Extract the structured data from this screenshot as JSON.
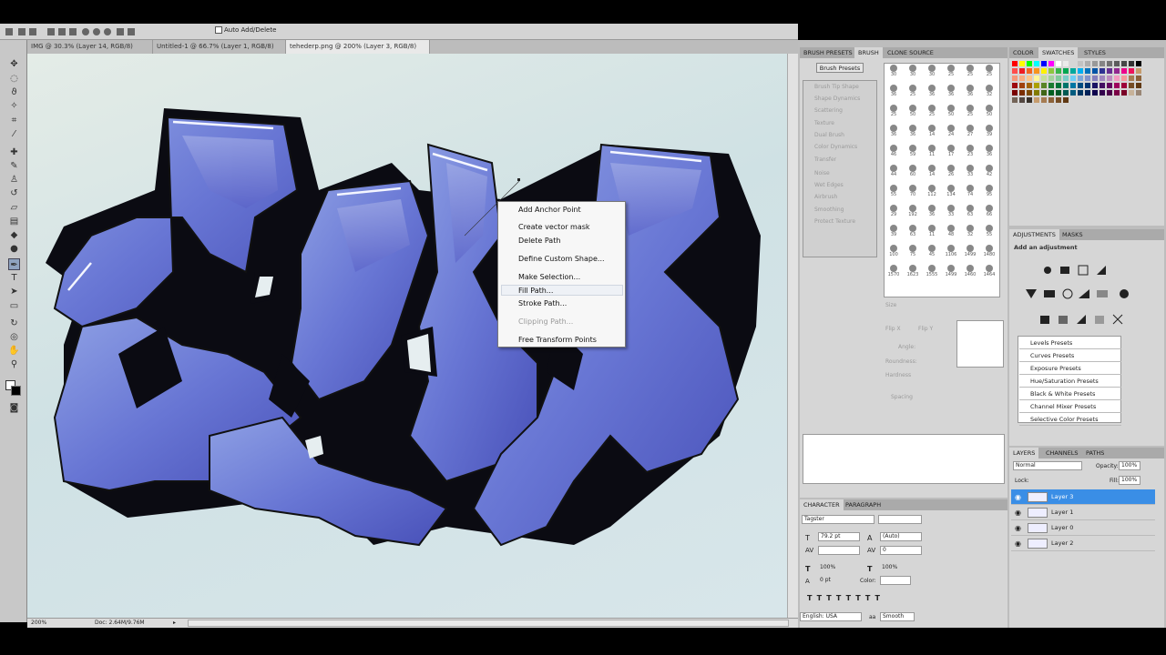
{
  "options_bar": {
    "auto_add_delete": "Auto Add/Delete"
  },
  "doc_tabs": [
    {
      "label": "IMG @ 30.3% (Layer 14, RGB/8) *",
      "close": "×"
    },
    {
      "label": "Untitled-1 @ 66.7% (Layer 1, RGB/8) *",
      "close": "×"
    },
    {
      "label": "tehederp.png @ 200% (Layer 3, RGB/8) *",
      "close": "×"
    }
  ],
  "status": {
    "zoom": "200%",
    "doc": "Doc: 2.64M/9.76M"
  },
  "context_menu": [
    {
      "label": "Add Anchor Point",
      "disabled": false
    },
    {
      "label": "Create vector mask",
      "disabled": false
    },
    {
      "label": "Delete Path",
      "disabled": false
    },
    {
      "label": "Define Custom Shape...",
      "disabled": false
    },
    {
      "label": "Make Selection...",
      "disabled": false
    },
    {
      "label": "Fill Path...",
      "disabled": false
    },
    {
      "label": "Stroke Path...",
      "disabled": false
    },
    {
      "label": "Clipping Path...",
      "disabled": true
    },
    {
      "label": "Free Transform Points",
      "disabled": false
    }
  ],
  "brush_panel": {
    "tabs": [
      "BRUSH PRESETS",
      "BRUSH",
      "CLONE SOURCE"
    ],
    "presets_button": "Brush Presets",
    "options": [
      "Brush Tip Shape",
      "Shape Dynamics",
      "Scattering",
      "Texture",
      "Dual Brush",
      "Color Dynamics",
      "Transfer",
      "Noise",
      "Wet Edges",
      "Airbrush",
      "Smoothing",
      "Protect Texture"
    ],
    "sizes": [
      "30",
      "30",
      "30",
      "25",
      "25",
      "25",
      "36",
      "25",
      "36",
      "36",
      "36",
      "32",
      "25",
      "50",
      "25",
      "50",
      "25",
      "50",
      "36",
      "36",
      "14",
      "24",
      "27",
      "39",
      "46",
      "59",
      "11",
      "17",
      "23",
      "36",
      "44",
      "60",
      "14",
      "26",
      "33",
      "42",
      "55",
      "70",
      "112",
      "134",
      "74",
      "95",
      "29",
      "192",
      "36",
      "33",
      "63",
      "66",
      "39",
      "63",
      "11",
      "48",
      "32",
      "55",
      "100",
      "75",
      "45",
      "1106",
      "1499",
      "1480",
      "1570",
      "1623",
      "1555",
      "1499",
      "1460",
      "1464"
    ],
    "size_label": "Size",
    "flip_x": "Flip X",
    "flip_y": "Flip Y",
    "angle": "Angle:",
    "roundness": "Roundness:",
    "hardness": "Hardness",
    "spacing": "Spacing"
  },
  "color_panel": {
    "tabs": [
      "COLOR",
      "SWATCHES",
      "STYLES"
    ],
    "swatches": [
      "#ff0000",
      "#ffff00",
      "#00ff00",
      "#00ffff",
      "#0000ff",
      "#ff00ff",
      "#ffffff",
      "#ebebeb",
      "#d6d6d6",
      "#c2c2c2",
      "#adadad",
      "#999999",
      "#858585",
      "#707070",
      "#5c5c5c",
      "#474747",
      "#333333",
      "#000000",
      "#ff4d4d",
      "#ee1c24",
      "#f26522",
      "#f7941d",
      "#fff200",
      "#8dc63f",
      "#39b54a",
      "#00a651",
      "#00a99d",
      "#00aeef",
      "#0072bc",
      "#0054a6",
      "#2e3192",
      "#662d91",
      "#92278f",
      "#ec008c",
      "#ed145b",
      "#c69c6d",
      "#f7977a",
      "#f9ad81",
      "#fdc68a",
      "#fff79a",
      "#c4df9b",
      "#a3d39c",
      "#82ca9d",
      "#7bcdc8",
      "#6dcff6",
      "#7da7d9",
      "#8393ca",
      "#8781bd",
      "#a186be",
      "#bd8cbf",
      "#f49ac1",
      "#f5989d",
      "#a67c52",
      "#8c6239",
      "#9e0b0f",
      "#a0410d",
      "#a36209",
      "#aba000",
      "#598527",
      "#1a7b30",
      "#007236",
      "#00746b",
      "#0076a3",
      "#004b80",
      "#003471",
      "#1b1464",
      "#440e62",
      "#630460",
      "#9e005d",
      "#9e0039",
      "#754c24",
      "#603913",
      "#790000",
      "#7b2e00",
      "#7d4900",
      "#827b00",
      "#406618",
      "#005e20",
      "#005826",
      "#005952",
      "#005b7f",
      "#003663",
      "#002157",
      "#0d004c",
      "#32004b",
      "#4b0049",
      "#7b0046",
      "#7a0026",
      "#c7b299",
      "#998675",
      "#736357",
      "#534741",
      "#37302a",
      "#c69c6d",
      "#a67c52",
      "#8c6239",
      "#754c24",
      "#603913"
    ]
  },
  "adjustments_panel": {
    "tabs": [
      "ADJUSTMENTS",
      "MASKS"
    ],
    "heading": "Add an adjustment",
    "presets": [
      "Levels Presets",
      "Curves Presets",
      "Exposure Presets",
      "Hue/Saturation Presets",
      "Black & White Presets",
      "Channel Mixer Presets",
      "Selective Color Presets"
    ]
  },
  "layers_panel": {
    "tabs": [
      "LAYERS",
      "CHANNELS",
      "PATHS"
    ],
    "blend_mode": "Normal",
    "opacity_label": "Opacity:",
    "opacity": "100%",
    "lock_label": "Lock:",
    "fill_label": "Fill:",
    "fill": "100%",
    "layers": [
      {
        "name": "Layer 3",
        "selected": true
      },
      {
        "name": "Layer 1",
        "selected": false
      },
      {
        "name": "Layer 0",
        "selected": false
      },
      {
        "name": "Layer 2",
        "selected": false
      }
    ]
  },
  "character_panel": {
    "tabs": [
      "CHARACTER",
      "PARAGRAPH"
    ],
    "font": "Tagster",
    "size": "79.2 pt",
    "leading": "(Auto)",
    "tracking": "0",
    "vscale": "100%",
    "hscale": "100%",
    "baseline": "0 pt",
    "color_label": "Color:",
    "language": "English: USA",
    "antialias_icon": "aa",
    "antialias": "Smooth"
  }
}
